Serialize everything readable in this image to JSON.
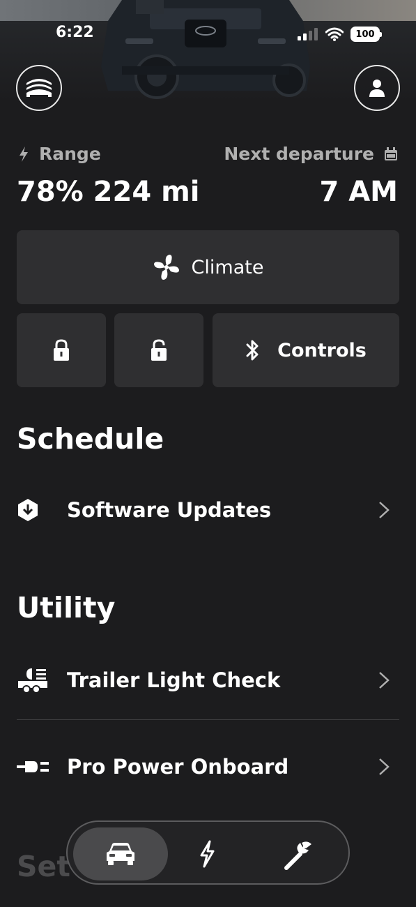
{
  "status_bar": {
    "time": "6:22",
    "battery": "100"
  },
  "header": {
    "garage_icon": "vehicle-switcher-icon",
    "profile_icon": "person-icon"
  },
  "summary": {
    "range_label": "Range",
    "range_value": "78% 224 mi",
    "departure_label": "Next departure",
    "departure_value": "7 AM"
  },
  "controls": {
    "climate_label": "Climate",
    "lock_icon": "lock-icon",
    "unlock_icon": "unlock-icon",
    "controls_label": "Controls"
  },
  "schedule": {
    "title": "Schedule",
    "items": [
      {
        "label": "Software Updates",
        "icon": "software-update-icon"
      }
    ]
  },
  "utility": {
    "title": "Utility",
    "items": [
      {
        "label": "Trailer Light Check",
        "icon": "trailer-light-icon"
      },
      {
        "label": "Pro Power Onboard",
        "icon": "power-plug-icon"
      }
    ]
  },
  "settings": {
    "title": "Set"
  },
  "tabbar": {
    "tabs": [
      {
        "icon": "vehicle-icon",
        "active": true
      },
      {
        "icon": "charging-icon",
        "active": false
      },
      {
        "icon": "wrench-icon",
        "active": false
      }
    ]
  },
  "colors": {
    "background": "#1c1c1e",
    "tile": "#2f2f31",
    "muted_text": "#b0b0b0"
  }
}
